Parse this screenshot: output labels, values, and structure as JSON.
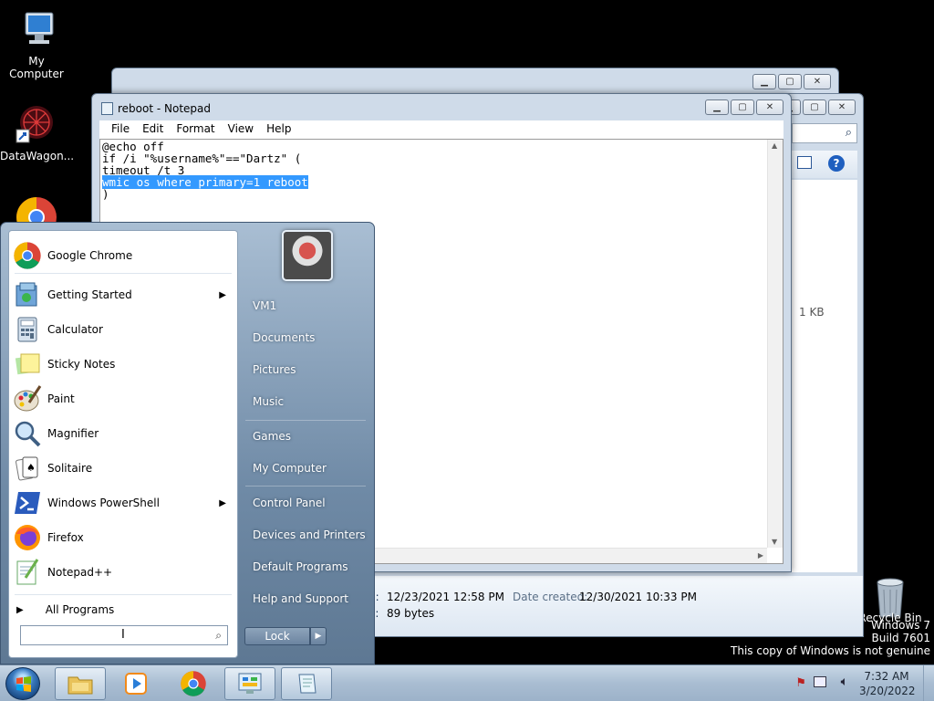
{
  "desktop": {
    "icons": [
      {
        "label": "My Computer",
        "icon": "computer-icon"
      },
      {
        "label": "DataWagon...",
        "icon": "datawagon-shortcut-icon"
      },
      {
        "label": "",
        "icon": "chrome-icon"
      },
      {
        "label": "Recycle Bin",
        "icon": "recycle-bin-icon"
      }
    ]
  },
  "notepad": {
    "title": "reboot - Notepad",
    "menu": [
      "File",
      "Edit",
      "Format",
      "View",
      "Help"
    ],
    "lines": [
      "@echo off",
      "if /i \"%username%\"==\"Dartz\" (",
      "timeout /t 3"
    ],
    "selected_line": "wmic os where primary=1 reboot",
    "last_line": ")"
  },
  "explorer": {
    "size_label": "1 KB",
    "modified_value": "12/23/2021 12:58 PM",
    "modified_prefix": "d:",
    "created_label": "Date created:",
    "created_value": "12/30/2021 10:33 PM",
    "size_prefix": "e:",
    "size_value": "89 bytes"
  },
  "start_menu": {
    "pinned": [
      {
        "label": "Google Chrome",
        "icon": "chrome-icon",
        "submenu": false
      },
      {
        "label": "Getting Started",
        "icon": "getting-started-icon",
        "submenu": true
      },
      {
        "label": "Calculator",
        "icon": "calculator-icon",
        "submenu": false
      },
      {
        "label": "Sticky Notes",
        "icon": "sticky-notes-icon",
        "submenu": false
      },
      {
        "label": "Paint",
        "icon": "paint-icon",
        "submenu": false
      },
      {
        "label": "Magnifier",
        "icon": "magnifier-icon",
        "submenu": false
      },
      {
        "label": "Solitaire",
        "icon": "solitaire-icon",
        "submenu": false
      },
      {
        "label": "Windows PowerShell",
        "icon": "powershell-icon",
        "submenu": true
      },
      {
        "label": "Firefox",
        "icon": "firefox-icon",
        "submenu": false
      },
      {
        "label": "Notepad++",
        "icon": "notepadpp-icon",
        "submenu": false
      }
    ],
    "all_programs": "All Programs",
    "search_placeholder": "",
    "right": [
      "VM1",
      "Documents",
      "Pictures",
      "Music",
      "Games",
      "My Computer",
      "Control Panel",
      "Devices and Printers",
      "Default Programs",
      "Help and Support"
    ],
    "lock_label": "Lock"
  },
  "taskbar": {
    "buttons": [
      "explorer-icon",
      "media-player-icon",
      "chrome-icon",
      "control-panel-icon",
      "notepad-icon"
    ],
    "time": "7:32 AM",
    "date": "3/20/2022"
  },
  "watermark": {
    "line1": "Windows 7",
    "line2": "Build 7601",
    "line3": "This copy of Windows is not genuine"
  },
  "colors": {
    "selection": "#3399ff",
    "taskbar": "#a9bdd2"
  }
}
